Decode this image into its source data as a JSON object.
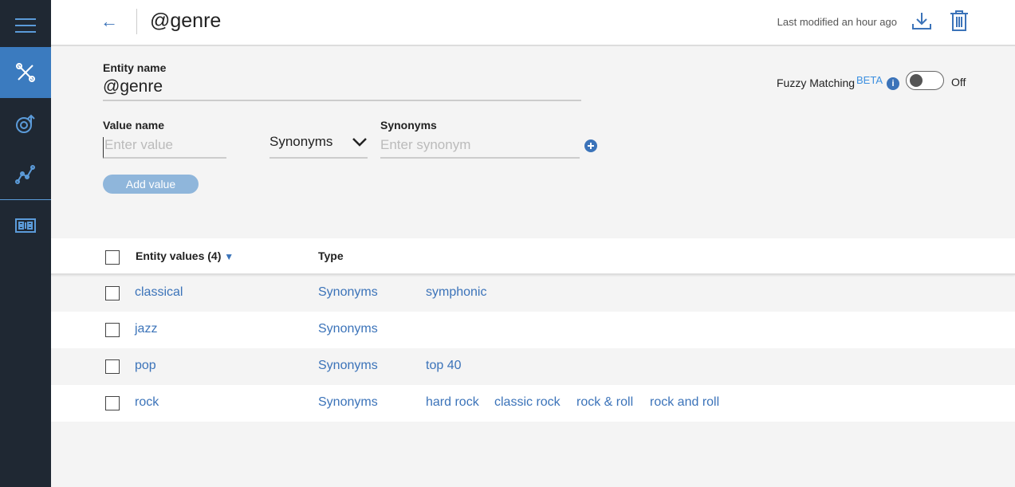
{
  "header": {
    "title": "@genre",
    "last_modified": "Last modified an hour ago"
  },
  "form": {
    "entity_name_label": "Entity name",
    "entity_name_value": "@genre",
    "value_name_label": "Value name",
    "value_placeholder": "Enter value",
    "type_select": "Synonyms",
    "synonyms_label": "Synonyms",
    "synonym_placeholder": "Enter synonym",
    "add_value": "Add value",
    "fuzzy_label": "Fuzzy Matching",
    "fuzzy_badge": "BETA",
    "fuzzy_state": "Off",
    "fuzzy_on": false
  },
  "table": {
    "col_values": "Entity values (4)",
    "col_type": "Type",
    "rows": [
      {
        "value": "classical",
        "type": "Synonyms",
        "synonyms": [
          "symphonic"
        ]
      },
      {
        "value": "jazz",
        "type": "Synonyms",
        "synonyms": []
      },
      {
        "value": "pop",
        "type": "Synonyms",
        "synonyms": [
          "top 40"
        ]
      },
      {
        "value": "rock",
        "type": "Synonyms",
        "synonyms": [
          "hard rock",
          "classic rock",
          "rock & roll",
          "rock and roll"
        ]
      }
    ]
  },
  "colors": {
    "sidebar": "#1f2833",
    "accent": "#3b73b9",
    "active": "#3b7bbf"
  }
}
